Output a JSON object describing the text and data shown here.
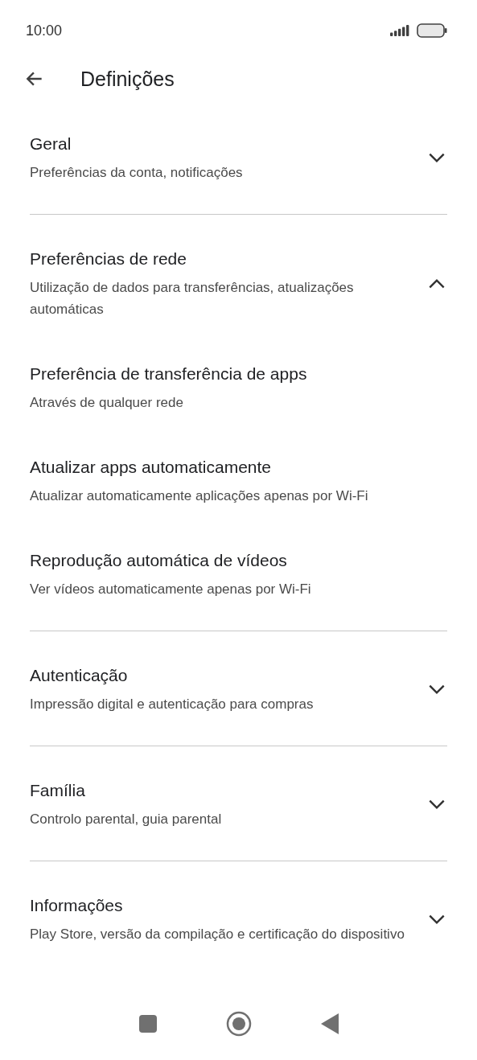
{
  "status_bar": {
    "time": "10:00"
  },
  "header": {
    "title": "Definições"
  },
  "sections": [
    {
      "title": "Geral",
      "subtitle": "Preferências da conta, notificações",
      "expanded": false
    },
    {
      "title": "Preferências de rede",
      "subtitle": "Utilização de dados para transferências, atualizações automáticas",
      "expanded": true,
      "children": [
        {
          "title": "Preferência de transferência de apps",
          "subtitle": "Através de qualquer rede"
        },
        {
          "title": "Atualizar apps automaticamente",
          "subtitle": "Atualizar automaticamente aplicações apenas por Wi-Fi"
        },
        {
          "title": "Reprodução automática de vídeos",
          "subtitle": "Ver vídeos automaticamente apenas por Wi-Fi"
        }
      ]
    },
    {
      "title": "Autenticação",
      "subtitle": "Impressão digital e autenticação para compras",
      "expanded": false
    },
    {
      "title": "Família",
      "subtitle": "Controlo parental, guia parental",
      "expanded": false
    },
    {
      "title": "Informações",
      "subtitle": "Play Store, versão da compilação e certificação do dispositivo",
      "expanded": false
    }
  ]
}
